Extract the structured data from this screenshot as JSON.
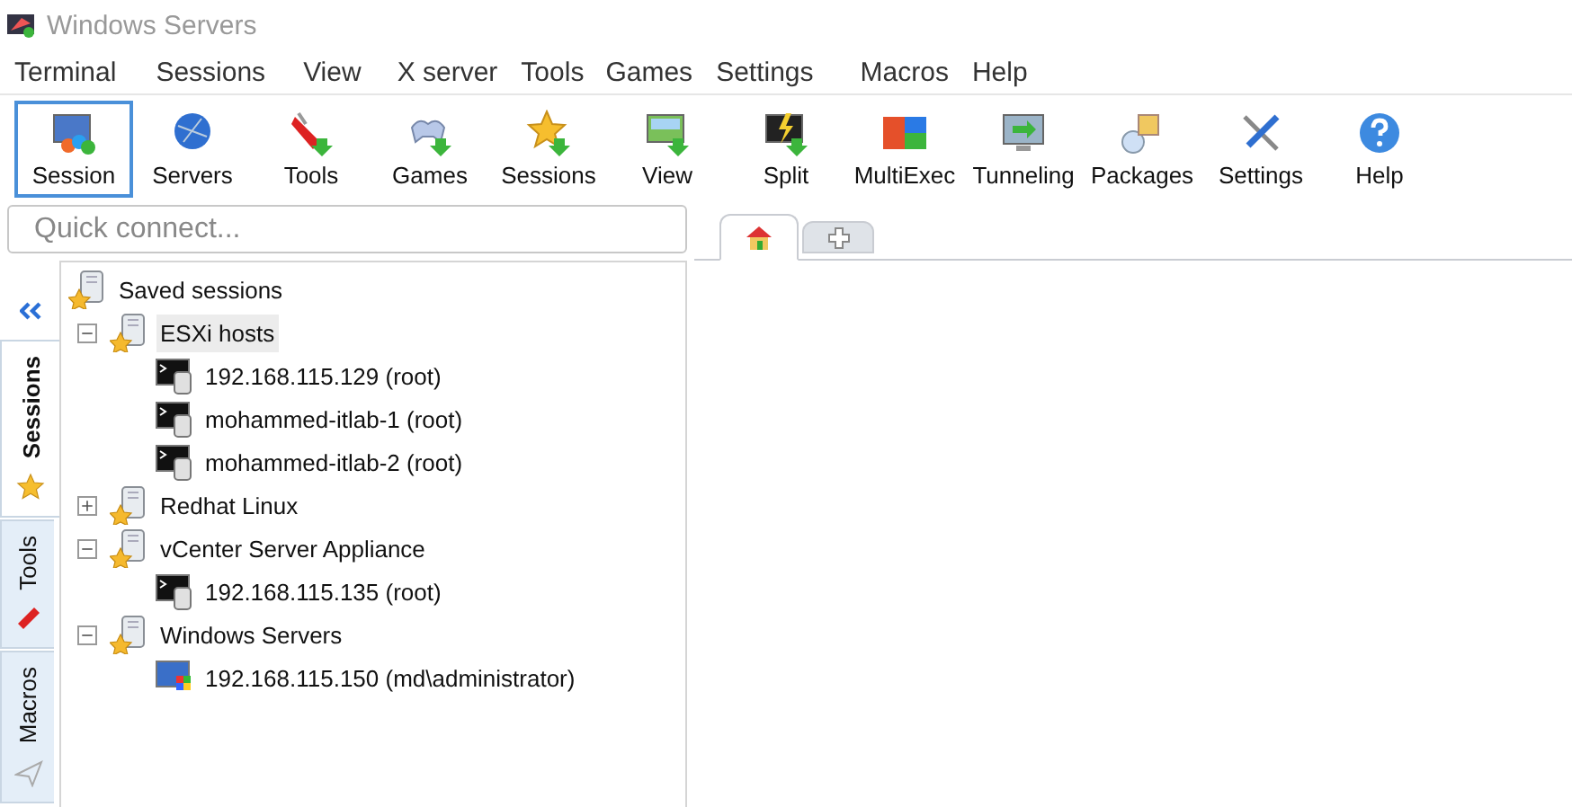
{
  "window": {
    "title": "Windows Servers"
  },
  "menu": [
    "Terminal",
    "Sessions",
    "View",
    "X server",
    "Tools",
    "Games",
    "Settings",
    "Macros",
    "Help"
  ],
  "toolbar": [
    {
      "kind": "session",
      "label": "Session",
      "selected": true
    },
    {
      "kind": "servers",
      "label": "Servers",
      "selected": false
    },
    {
      "kind": "tools",
      "label": "Tools",
      "selected": false
    },
    {
      "kind": "games",
      "label": "Games",
      "selected": false
    },
    {
      "kind": "sessions",
      "label": "Sessions",
      "selected": false
    },
    {
      "kind": "view",
      "label": "View",
      "selected": false
    },
    {
      "kind": "split",
      "label": "Split",
      "selected": false
    },
    {
      "kind": "multiexec",
      "label": "MultiExec",
      "selected": false
    },
    {
      "kind": "tunneling",
      "label": "Tunneling",
      "selected": false
    },
    {
      "kind": "packages",
      "label": "Packages",
      "selected": false
    },
    {
      "kind": "settings",
      "label": "Settings",
      "selected": false
    },
    {
      "kind": "help",
      "label": "Help",
      "selected": false
    }
  ],
  "quick_connect": {
    "placeholder": "Quick connect..."
  },
  "session_tabs": [
    {
      "kind": "home",
      "selected": true
    },
    {
      "kind": "new",
      "selected": false
    }
  ],
  "side_tabs": [
    {
      "kind": "sessions",
      "label": "Sessions",
      "selected": true
    },
    {
      "kind": "tools",
      "label": "Tools",
      "selected": false
    },
    {
      "kind": "macros",
      "label": "Macros",
      "selected": false
    }
  ],
  "tree": {
    "label": "Saved sessions",
    "children": [
      {
        "kind": "folder",
        "label": "ESXi hosts",
        "expanded": true,
        "selected": true,
        "children": [
          {
            "kind": "ssh",
            "label": "192.168.115.129 (root)",
            "selected": false
          },
          {
            "kind": "ssh",
            "label": "mohammed-itlab-1 (root)",
            "selected": false
          },
          {
            "kind": "ssh",
            "label": "mohammed-itlab-2 (root)",
            "selected": false
          }
        ]
      },
      {
        "kind": "folder",
        "label": "Redhat Linux",
        "expanded": false,
        "selected": false
      },
      {
        "kind": "folder",
        "label": "vCenter Server Appliance",
        "expanded": true,
        "selected": false,
        "children": [
          {
            "kind": "ssh",
            "label": "192.168.115.135 (root)",
            "selected": false
          }
        ]
      },
      {
        "kind": "folder",
        "label": "Windows Servers",
        "expanded": true,
        "selected": false,
        "children": [
          {
            "kind": "rdp",
            "label": "192.168.115.150 (md\\administrator)",
            "selected": false
          }
        ]
      }
    ]
  }
}
